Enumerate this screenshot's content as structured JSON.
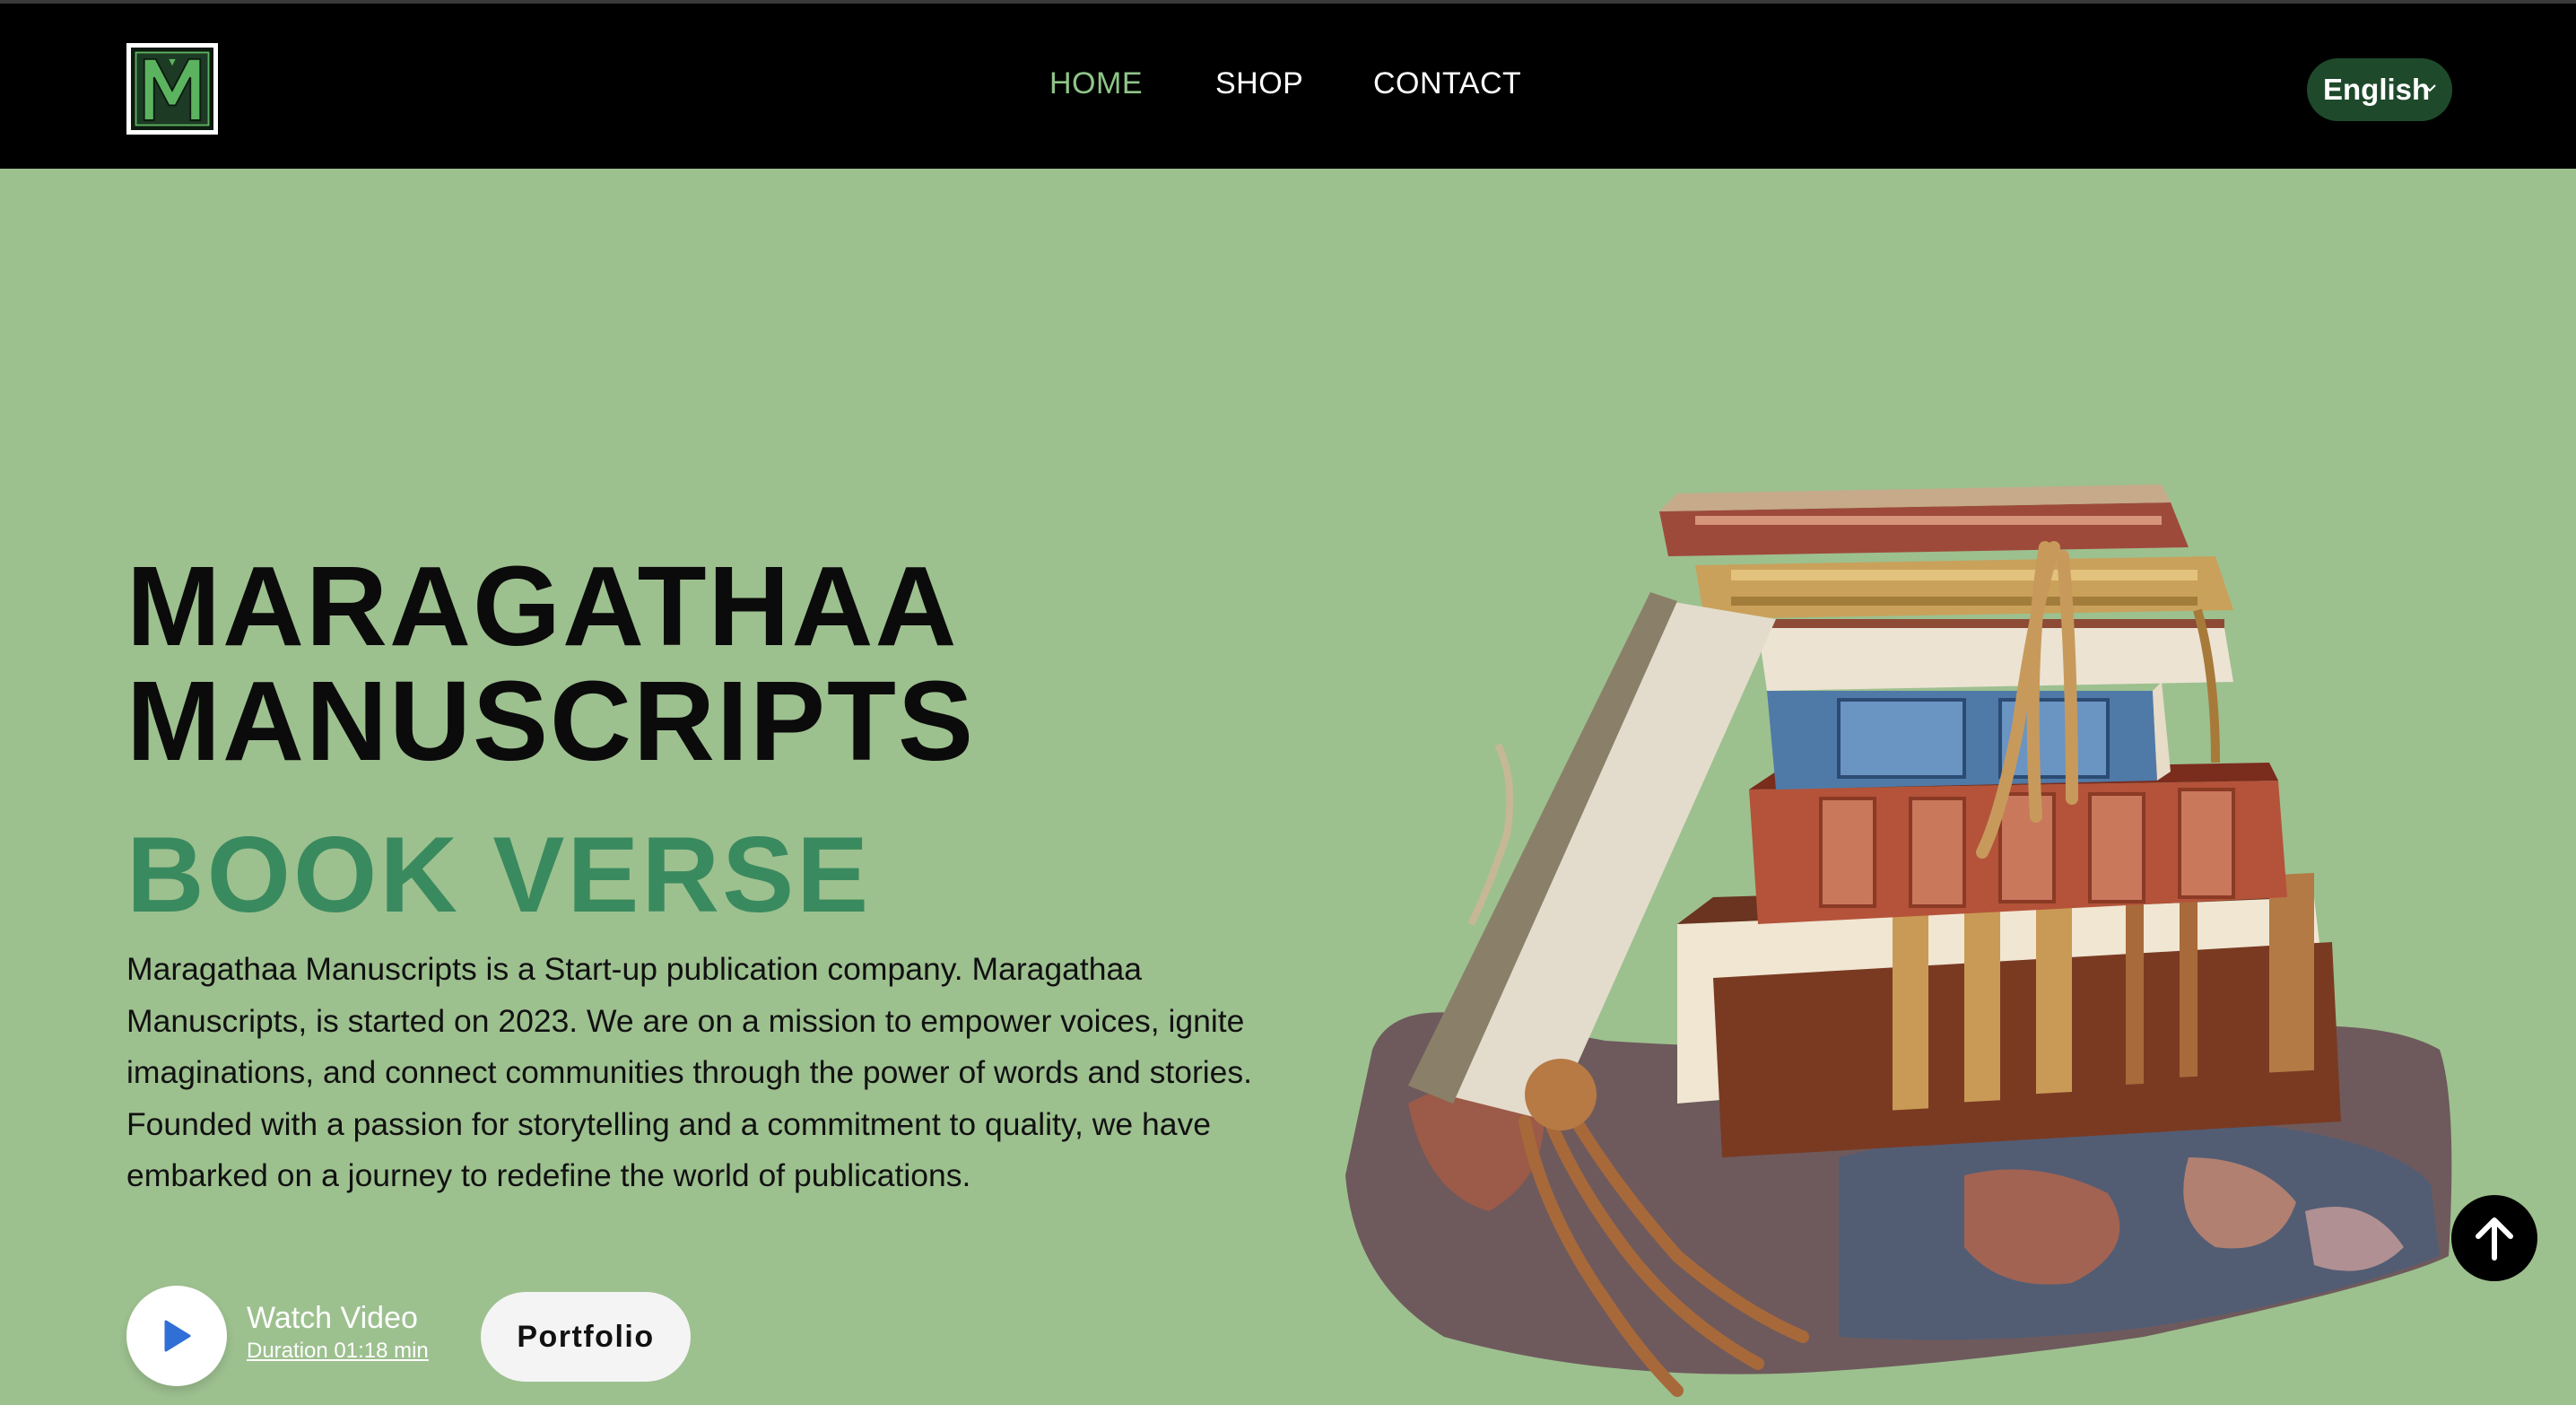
{
  "header": {
    "logo_alt": "M",
    "nav": {
      "home": "HOME",
      "shop": "SHOP",
      "contact": "CONTACT"
    },
    "active_nav": "home",
    "language": {
      "selected": "English"
    }
  },
  "hero": {
    "title_line1": "MARAGATHAA",
    "title_line2": "MANUSCRIPTS",
    "subtitle": "BOOK VERSE",
    "description": "Maragathaa Manuscripts is a Start-up publication company. Maragathaa Manuscripts, is started on 2023. We are on a mission to empower voices, ignite imaginations, and connect communities through the power of words and stories. Founded with a passion for storytelling and a commitment to quality, we have embarked on a journey to redefine the world of publications.",
    "watch_video_label": "Watch Video",
    "duration_label": "Duration 01:18 min",
    "portfolio_label": "Portfolio"
  },
  "icons": {
    "logo": "m-monogram-logo",
    "language_dropdown": "chevron-down-icon",
    "play": "play-icon",
    "scroll_top": "arrow-up-icon",
    "hero_image": "stack-of-books-illustration"
  },
  "colors": {
    "page_background": "#9dc08f",
    "header_background": "#000000",
    "nav_active": "#8fc589",
    "subtitle": "#3a8a5f",
    "language_pill": "#1e4a2b"
  }
}
